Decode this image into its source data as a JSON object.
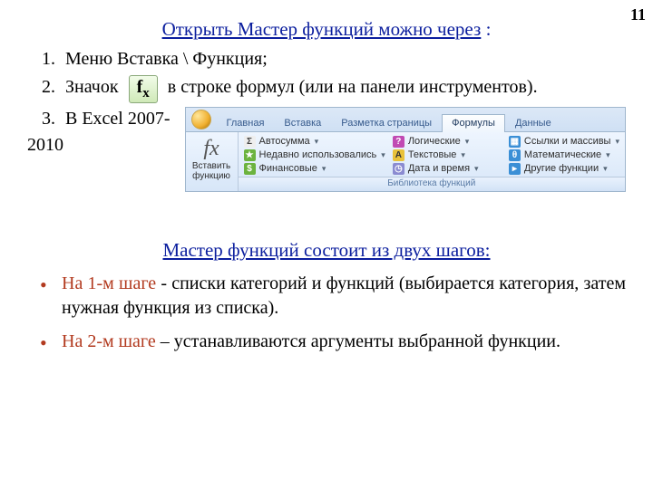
{
  "page_number": "11",
  "heading1_underline": "Открыть Мастер функций можно через",
  "heading1_trail": " :",
  "list": {
    "i1": "Меню Вставка \\ Функция;",
    "i2a": "Значок",
    "i2b": "в строке формул (или на панели инструментов).",
    "i3": "В Excel 2007-",
    "year": "2010"
  },
  "fx_label": "f",
  "fx_sub": "x",
  "ribbon": {
    "tabs": {
      "home": "Главная",
      "insert": "Вставка",
      "layout": "Разметка страницы",
      "formulas": "Формулы",
      "data": "Данные"
    },
    "insert_fn_line1": "Вставить",
    "insert_fn_line2": "функцию",
    "cmds": {
      "autosum": "Автосумма",
      "recent": "Недавно использовались",
      "financial": "Финансовые",
      "logical": "Логические",
      "text": "Текстовые",
      "datetime": "Дата и время",
      "lookup": "Ссылки и массивы",
      "math": "Математические",
      "other": "Другие функции"
    },
    "group_caption": "Библиотека функций"
  },
  "heading2": "Мастер функций состоит из двух шагов:",
  "step1_red": "На 1-м шаге",
  "step1_rest": "  - списки категорий и функций (выбирается категория, затем нужная функция из списка).",
  "step2_red": "На 2-м шаге",
  "step2_rest": " – устанавливаются аргументы выбранной функции."
}
